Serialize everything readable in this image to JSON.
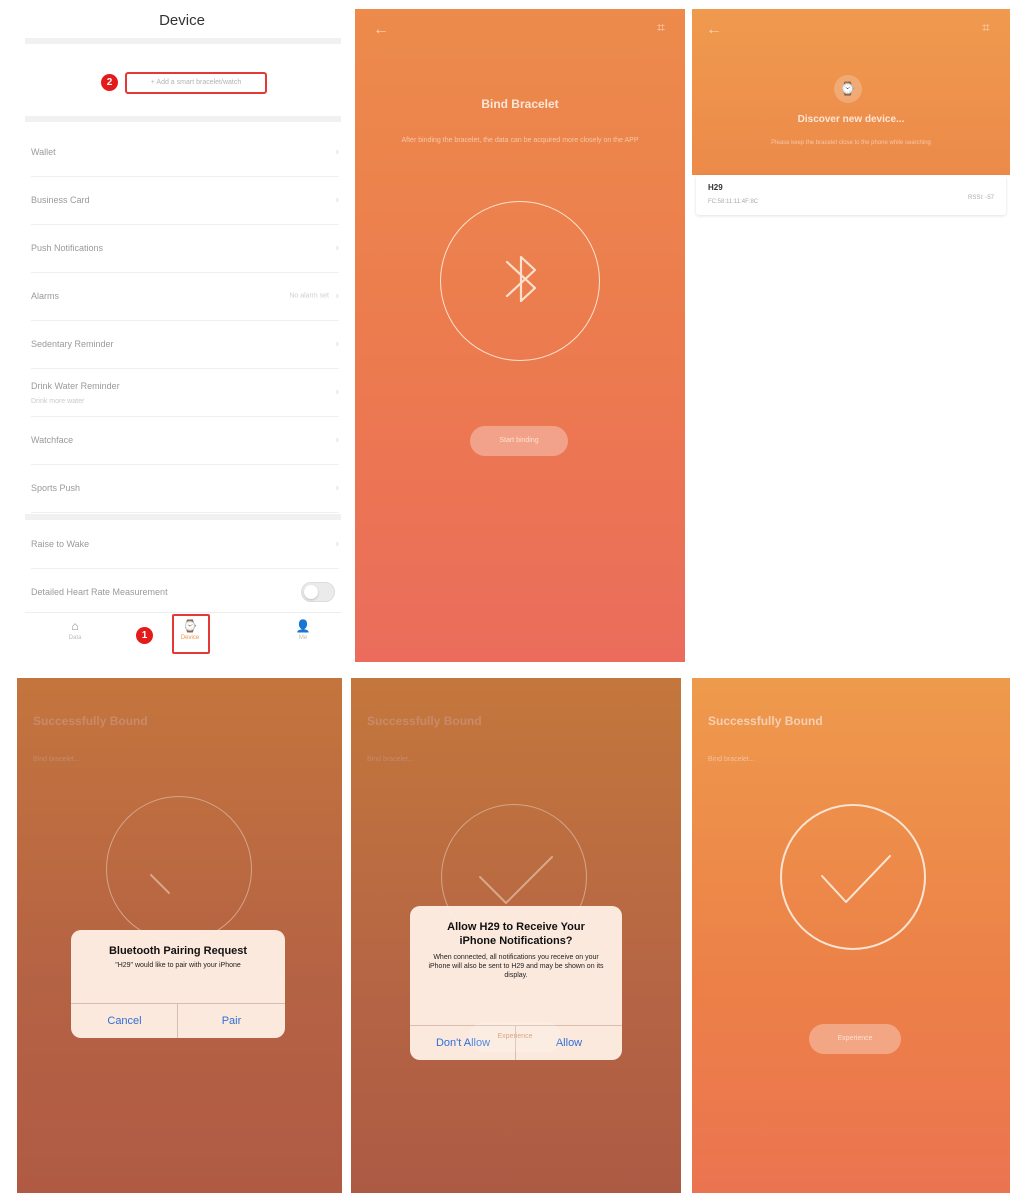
{
  "device_screen": {
    "title": "Device",
    "add_device_label": "+ Add a smart bracelet/watch",
    "step_marker_top": "2",
    "step_marker_bottom": "1",
    "settings": [
      {
        "label": "Wallet"
      },
      {
        "label": "Business Card"
      },
      {
        "label": "Push Notifications"
      },
      {
        "label": "Alarms",
        "value": "No alarm set"
      },
      {
        "label": "Sedentary Reminder"
      },
      {
        "label": "Drink Water Reminder",
        "sublabel": "Drink more water"
      },
      {
        "label": "Watchface"
      },
      {
        "label": "Sports Push"
      },
      {
        "label": "Raise to Wake"
      },
      {
        "label": "Detailed Heart Rate Measurement"
      }
    ],
    "tabs": [
      {
        "label": "Data",
        "icon": "home-icon"
      },
      {
        "label": "Device",
        "icon": "device-icon"
      },
      {
        "label": "Me",
        "icon": "person-icon"
      }
    ]
  },
  "bind_screen": {
    "title": "Bind Bracelet",
    "description": "After binding the bracelet, the data can be acquired more closely on the APP",
    "button": "Start binding"
  },
  "discover_screen": {
    "title": "Discover new device...",
    "description": "Please keep the bracelet close to the phone while searching",
    "device_name": "H29",
    "device_mac": "FC:58:11:11:4F:8C",
    "device_rssi": "RSSI: -57"
  },
  "bound_screens": [
    {
      "title": "Successfully Bound",
      "subtitle": "Bind bracelet...",
      "button": ""
    },
    {
      "title": "Successfully Bound",
      "subtitle": "Bind bracelet...",
      "button": "Experience"
    },
    {
      "title": "Successfully Bound",
      "subtitle": "Bind bracelet...",
      "button": "Experience"
    }
  ],
  "pairing_alert": {
    "title": "Bluetooth Pairing Request",
    "message": "\"H29\" would like to pair with your iPhone",
    "cancel": "Cancel",
    "confirm": "Pair"
  },
  "notification_alert": {
    "title": "Allow H29 to Receive Your iPhone Notifications?",
    "message": "When connected, all notifications you receive on your iPhone will also be sent to H29 and may be shown on its display.",
    "deny": "Don't Allow",
    "allow": "Allow"
  },
  "colors": {
    "accent_orange": "#ec8b4b",
    "highlight_red": "#e53935",
    "ios_blue": "#2f6fd8"
  }
}
